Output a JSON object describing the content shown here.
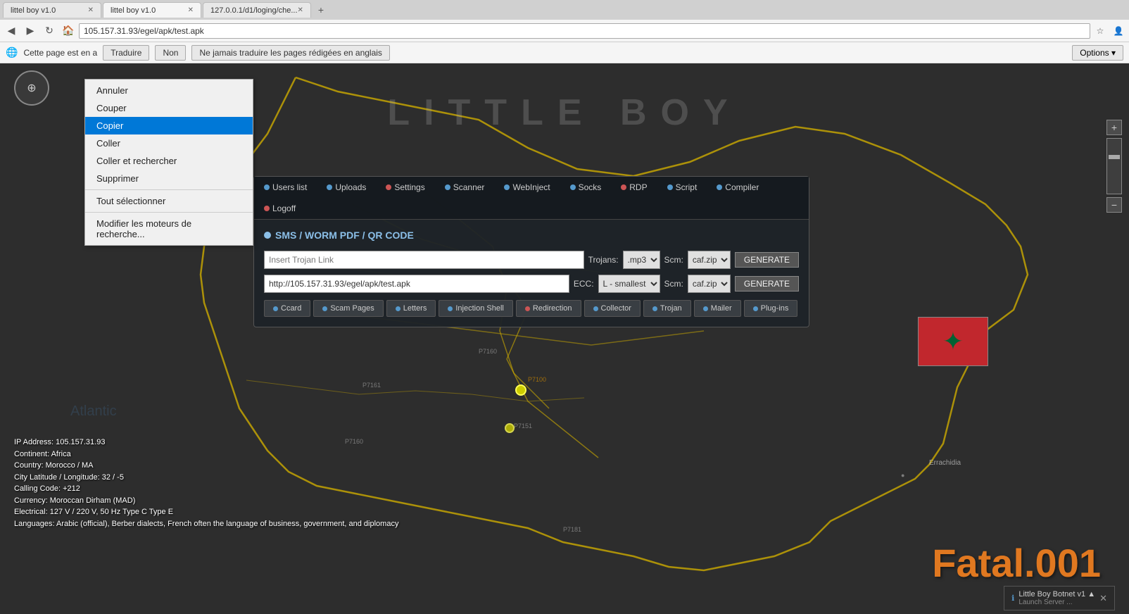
{
  "browser": {
    "tabs": [
      {
        "id": "tab1",
        "label": "littel boy v1.0",
        "active": false,
        "url": ""
      },
      {
        "id": "tab2",
        "label": "littel boy v1.0",
        "active": true,
        "url": ""
      },
      {
        "id": "tab3",
        "label": "127.0.0.1/d1/loging/che...",
        "active": false,
        "url": ""
      }
    ],
    "address_value": "105.157.31.93/egel/apk/test.apk",
    "nav_buttons": [
      "←",
      "→",
      "↻",
      "🏠"
    ]
  },
  "translation_bar": {
    "text": "Cette page est en a",
    "translate_btn": "Traduire",
    "no_btn": "Non",
    "never_btn": "Ne jamais traduire les pages rédigées en anglais",
    "options_btn": "Options ▾"
  },
  "context_menu": {
    "items": [
      {
        "label": "Annuler",
        "active": false,
        "divider_after": false
      },
      {
        "label": "Couper",
        "active": false,
        "divider_after": false
      },
      {
        "label": "Copier",
        "active": true,
        "divider_after": false
      },
      {
        "label": "Coller",
        "active": false,
        "divider_after": false
      },
      {
        "label": "Coller et rechercher",
        "active": false,
        "divider_after": false
      },
      {
        "label": "Supprimer",
        "active": false,
        "divider_after": true
      },
      {
        "label": "Tout sélectionner",
        "active": false,
        "divider_after": true
      },
      {
        "label": "Modifier les moteurs de recherche...",
        "active": false,
        "divider_after": false
      }
    ]
  },
  "map": {
    "title": "LITTLE BOY",
    "ip_info": [
      "IP Address: 105.157.31.93",
      "Continent: Africa",
      "Country: Morocco / MA",
      "City Latitude / Longitude: 32 / -5",
      "Calling Code: +212",
      "Currency: Moroccan Dirham (MAD)",
      "Electrical: 127 V / 220 V, 50 Hz Type C Type E",
      "Languages: Arabic (official), Berber dialects, French often the language of business, government, and diplomacy"
    ]
  },
  "panel": {
    "nav_items": [
      {
        "label": "Users list",
        "dot_color": "#5599cc"
      },
      {
        "label": "Uploads",
        "dot_color": "#5599cc"
      },
      {
        "label": "Settings",
        "dot_color": "#cc5555"
      },
      {
        "label": "Scanner",
        "dot_color": "#5599cc"
      },
      {
        "label": "WebInject",
        "dot_color": "#5599cc"
      },
      {
        "label": "Socks",
        "dot_color": "#5599cc"
      },
      {
        "label": "RDP",
        "dot_color": "#cc5555"
      },
      {
        "label": "Script",
        "dot_color": "#5599cc"
      },
      {
        "label": "Compiler",
        "dot_color": "#5599cc"
      },
      {
        "label": "Logoff",
        "dot_color": "#cc5555"
      }
    ],
    "title": "SMS / WORM PDF / QR CODE",
    "trojan_link_placeholder": "Insert Trojan Link",
    "trojan_link_value": "",
    "apk_url": "http://105.157.31.93/egel/apk/test.apk",
    "trojans_label": "Trojans:",
    "trojans_option": ".mp3",
    "scm1_label": "Scm:",
    "scm1_option": "caf.zip",
    "generate1_label": "GENERATE",
    "ecc_label": "ECC:",
    "ecc_option": "smallest",
    "scm2_label": "Scm:",
    "scm2_option": "caf.zip",
    "generate2_label": "GENERATE",
    "bottom_tabs": [
      {
        "label": "Ccard",
        "dot_color": "#5599cc"
      },
      {
        "label": "Scam Pages",
        "dot_color": "#5599cc"
      },
      {
        "label": "Letters",
        "dot_color": "#5599cc"
      },
      {
        "label": "Injection Shell",
        "dot_color": "#5599cc"
      },
      {
        "label": "Redirection",
        "dot_color": "#cc5555"
      },
      {
        "label": "Collector",
        "dot_color": "#5599cc"
      },
      {
        "label": "Trojan",
        "dot_color": "#5599cc"
      },
      {
        "label": "Mailer",
        "dot_color": "#5599cc"
      },
      {
        "label": "Plug-ins",
        "dot_color": "#5599cc"
      }
    ]
  },
  "watermark": "Fatal.001",
  "notification": {
    "icon": "ℹ",
    "title": "Little Boy Botnet v1 ▲",
    "subtitle": "Launch Server ..."
  }
}
